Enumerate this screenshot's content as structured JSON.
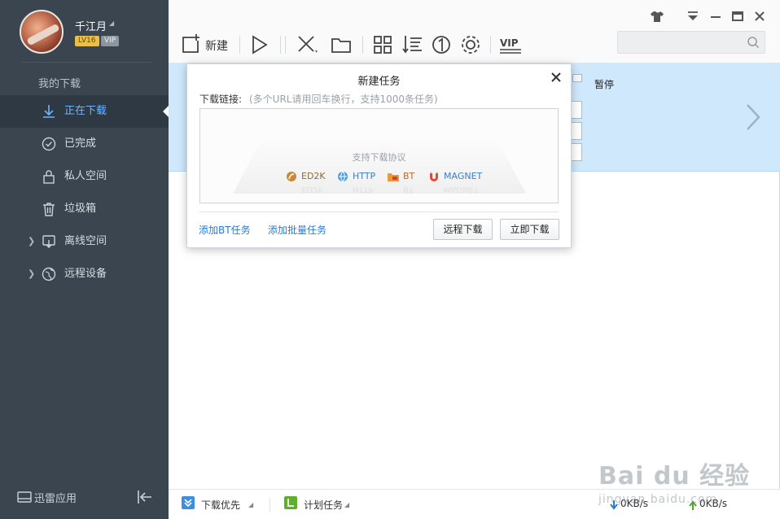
{
  "sidebar": {
    "user": {
      "name": "千江月",
      "level": "LV16",
      "vip": "VIP"
    },
    "heading": "我的下载",
    "items": [
      {
        "label": "正在下载",
        "icon": "download-arrow-icon",
        "active": true
      },
      {
        "label": "已完成",
        "icon": "check-circle-icon"
      },
      {
        "label": "私人空间",
        "icon": "lock-icon"
      },
      {
        "label": "垃圾箱",
        "icon": "trash-icon"
      },
      {
        "label": "离线空间",
        "icon": "cloud-download-icon",
        "expandable": true
      },
      {
        "label": "远程设备",
        "icon": "globe-icon",
        "expandable": true
      }
    ],
    "footer": {
      "label": "迅雷应用"
    }
  },
  "toolbar": {
    "new_label": "新建",
    "icons": [
      "new-task-icon",
      "play-icon",
      "delete-icon",
      "open-folder-icon",
      "grid-icon",
      "sort-icon",
      "one-icon",
      "settings-gear-icon",
      "vip-icon"
    ]
  },
  "search": {
    "placeholder": "",
    "value": ""
  },
  "task": {
    "status": "暂停"
  },
  "dialog": {
    "title": "新建任务",
    "link_label": "下载链接:",
    "link_hint": "(多个URL请用回车换行，支持1000条任务)",
    "protocols_title": "支持下载协议",
    "protocols": [
      "ED2K",
      "HTTP",
      "BT",
      "MAGNET"
    ],
    "add_bt": "添加BT任务",
    "add_batch": "添加批量任务",
    "remote_download": "远程下载",
    "download_now": "立即下载"
  },
  "statusbar": {
    "priority": "下载优先",
    "schedule": "计划任务",
    "download_speed": "0KB/s",
    "upload_speed": "0KB/s"
  },
  "colors": {
    "sidebar_bg": "#3b4550",
    "active_text": "#6cb6ff",
    "task_row_bg": "#cfe8fb",
    "link": "#2a7ad2"
  },
  "watermark": {
    "main": "Bai du 经验",
    "sub": "jingyan.baidu.com"
  }
}
